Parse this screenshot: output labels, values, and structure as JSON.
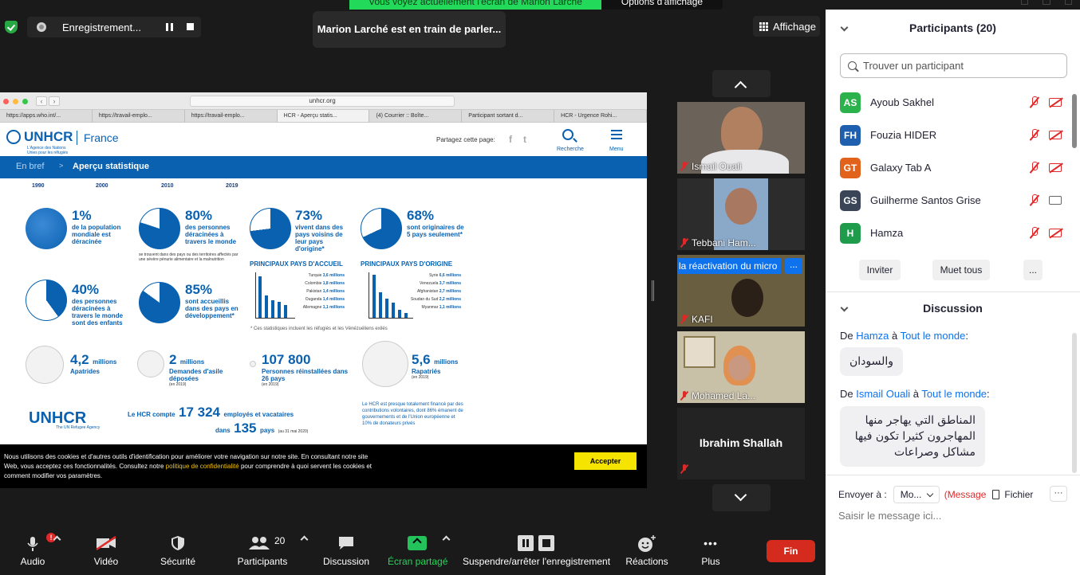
{
  "top": {
    "banner": "Vous voyez actuellement l'écran de Marion Larché",
    "view_options": "Options d'affichage",
    "recording_label": "Enregistrement...",
    "speaking": "Marion Larché est en train de parler...",
    "view_button": "Affichage"
  },
  "browser": {
    "url": "unhcr.org",
    "tabs": [
      "https://apps.who.int/...",
      "https://travail-emplo...",
      "https://travail-emplo...",
      "HCR - Aperçu statis...",
      "(4) Courrier :: Boîte...",
      "Participant sortant d...",
      "HCR - Urgence Rohi..."
    ]
  },
  "site": {
    "logo": "UNHCR",
    "logo_sub": "L'Agence des Nations Unies pour les réfugiés",
    "logo_country": "France",
    "share_page": "Partagez cette page:",
    "social": [
      "f",
      "t"
    ],
    "search_label": "Recherche",
    "menu_label": "Menu",
    "crumb1": "En bref",
    "crumb_sep": ">",
    "crumb2": "Aperçu statistique",
    "years": [
      "1990",
      "2000",
      "2010",
      "2019"
    ],
    "stats": [
      {
        "big": "1%",
        "txt": "de la population mondiale est déracinée"
      },
      {
        "big": "80%",
        "txt": "des personnes déracinées à travers le monde",
        "tiny": "se trouvent dans des pays ou des territoires affectés par une sévère pénurie alimentaire et la malnutrition"
      },
      {
        "big": "73%",
        "txt": "vivent dans des pays voisins de leur pays d'origine*"
      },
      {
        "big": "68%",
        "txt": "sont originaires de 5 pays seulement*"
      },
      {
        "big": "40%",
        "txt": "des personnes déracinées à travers le monde sont des enfants"
      },
      {
        "big": "85%",
        "txt": "sont accueillis dans des pays en développement*"
      }
    ],
    "host_title": "PRINCIPAUX PAYS D'ACCUEIL",
    "host_list": [
      [
        "Turquie",
        "3,6 millions"
      ],
      [
        "Colombie",
        "1,8 millions"
      ],
      [
        "Pakistan",
        "1,4 millions"
      ],
      [
        "Ouganda",
        "1,4 millions"
      ],
      [
        "Allemagne",
        "1,1 millions"
      ]
    ],
    "origin_title": "PRINCIPAUX PAYS D'ORIGINE",
    "origin_list": [
      [
        "Syrie",
        "6,6 millions"
      ],
      [
        "Venezuela",
        "3,7 millions"
      ],
      [
        "Afghanistan",
        "2,7 millions"
      ],
      [
        "Soudan du Sud",
        "2,2 millions"
      ],
      [
        "Myanmar",
        "1,1 millions"
      ]
    ],
    "footnote": "* Ces statistiques incluent les réfugiés et les Vénézuéliens exilés",
    "bottom_stats": [
      {
        "big": "4,2",
        "unit": "millions",
        "txt": "Apatrides"
      },
      {
        "big": "2",
        "unit": "millions",
        "txt": "Demandes d'asile déposées",
        "note": "(en 2019)"
      },
      {
        "big": "107 800",
        "unit": "",
        "txt": "Personnes réinstallées dans 26 pays",
        "note": "(en 2019)"
      },
      {
        "big": "5,6",
        "unit": "millions",
        "txt": "Rapatriés",
        "note": "(en 2019)"
      }
    ],
    "unhcr_en": "UNHCR",
    "unhcr_en_sub": "The UN Refugee Agency",
    "staff_pre": "Le HCR compte",
    "staff_num": "17 324",
    "staff_post": "employés et vacataires",
    "staff_in": "dans",
    "countries_num": "135",
    "countries_post": "pays",
    "staff_date": "(au 31 mai 2020)",
    "funding": "Le HCR est presque totalement financé par des contributions volontaires, dont 86% émanent de gouvernements et de l'Union européenne et 10% de donateurs privés"
  },
  "cookie": {
    "text1": "Nous utilisons des cookies et d'autres outils d'identification pour améliorer votre navigation sur notre site. En consultant notre site Web, vous acceptez ces fonctionnalités. Consultez notre ",
    "link": "politique de confidentialité",
    "text2": " pour comprendre à quoi servent les cookies et comment modifier vos paramètres.",
    "accept": "Accepter"
  },
  "videos": [
    {
      "name": "Ismail Ouali"
    },
    {
      "name": "Tebbani Ham..."
    },
    {
      "name": "KAFI"
    },
    {
      "name": "Mohamed La..."
    },
    {
      "name": "Ibrahim Shallah"
    }
  ],
  "tooltip": "la réactivation du micro",
  "tile_more": "...",
  "toolbar": {
    "audio": "Audio",
    "audio_badge": "!",
    "video": "Vidéo",
    "security": "Sécurité",
    "participants": "Participants",
    "participants_count": "20",
    "chat": "Discussion",
    "share": "Écran partagé",
    "record": "Suspendre/arrêter l'enregistrement",
    "reactions": "Réactions",
    "more": "Plus",
    "more_dots": "•••",
    "end": "Fin"
  },
  "panel": {
    "participants_title": "Participants (20)",
    "search_placeholder": "Trouver un participant",
    "participants": [
      {
        "initials": "AS",
        "name": "Ayoub Sakhel",
        "color": "#2bb24c",
        "cam": "off"
      },
      {
        "initials": "FH",
        "name": "Fouzia HIDER",
        "color": "#1f5fb0",
        "cam": "off"
      },
      {
        "initials": "GT",
        "name": "Galaxy Tab A",
        "color": "#e0621b",
        "cam": "off"
      },
      {
        "initials": "GS",
        "name": "Guilherme Santos Grise",
        "color": "#3a4658",
        "cam": "on"
      },
      {
        "initials": "H",
        "name": "Hamza",
        "color": "#1f9c4b",
        "cam": "off"
      }
    ],
    "invite": "Inviter",
    "mute_all": "Muet tous",
    "more": "...",
    "chat_title": "Discussion",
    "messages": [
      {
        "from_pre": "De ",
        "from": "Hamza",
        "to_pre": " à ",
        "to": "Tout le monde",
        "to_post": ":",
        "text": "والسودان"
      },
      {
        "from_pre": "De ",
        "from": "Ismail Ouali",
        "to_pre": " à ",
        "to": "Tout le monde",
        "to_post": ":",
        "text": "المناطق التي يهاجر منها المهاجرون كثيرا تكون فيها مشاكل وصراعات"
      }
    ],
    "send_to_label": "Envoyer à :",
    "send_to_value": "Mo...",
    "message_mode": "(Message",
    "file": "Fichier",
    "more_dots": "···",
    "input_placeholder": "Saisir le message ici..."
  }
}
